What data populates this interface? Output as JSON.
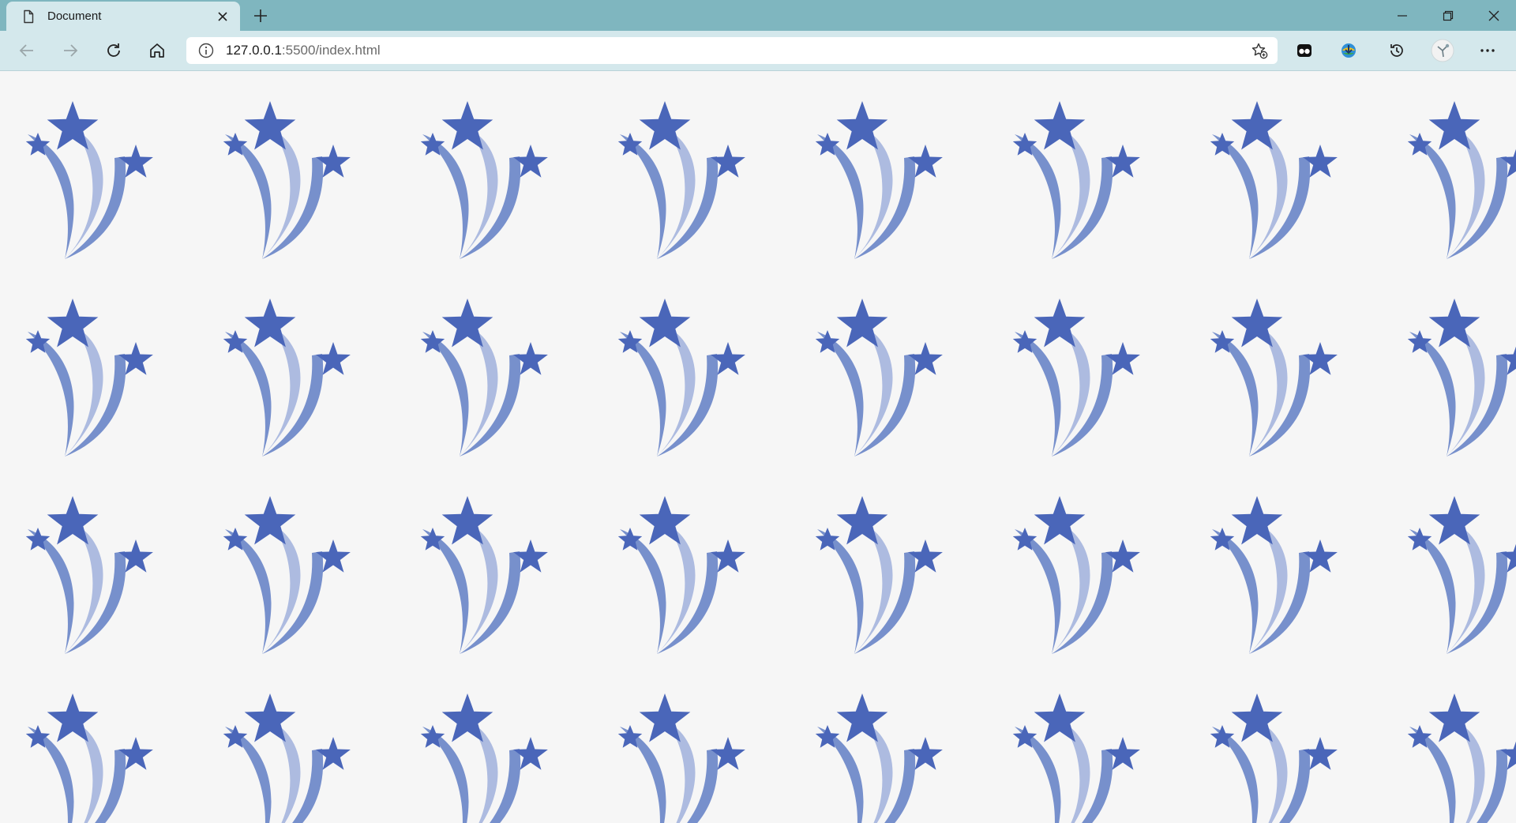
{
  "browser": {
    "tab": {
      "title": "Document",
      "icon": "document-icon"
    },
    "new_tab_icon": "plus-icon",
    "address": {
      "host": "127.0.0.1",
      "path": ":5500/index.html"
    },
    "toolbar_icons": [
      "back-icon",
      "forward-icon",
      "refresh-icon",
      "home-icon",
      "info-icon",
      "add-favorite-icon",
      "extension-icon",
      "idm-extension-icon",
      "history-icon",
      "profile-avatar-icon",
      "more-icon"
    ],
    "window_controls": [
      "minimize-icon",
      "restore-icon",
      "close-icon"
    ]
  },
  "page": {
    "background": "#f6f6f6",
    "pattern": {
      "icon": "shooting-stars-icon",
      "rows": 4,
      "columns": 8,
      "colors": {
        "star": "#4a66b9",
        "trail_dark": "#7790cc",
        "trail_light": "#adbbe0"
      }
    }
  }
}
